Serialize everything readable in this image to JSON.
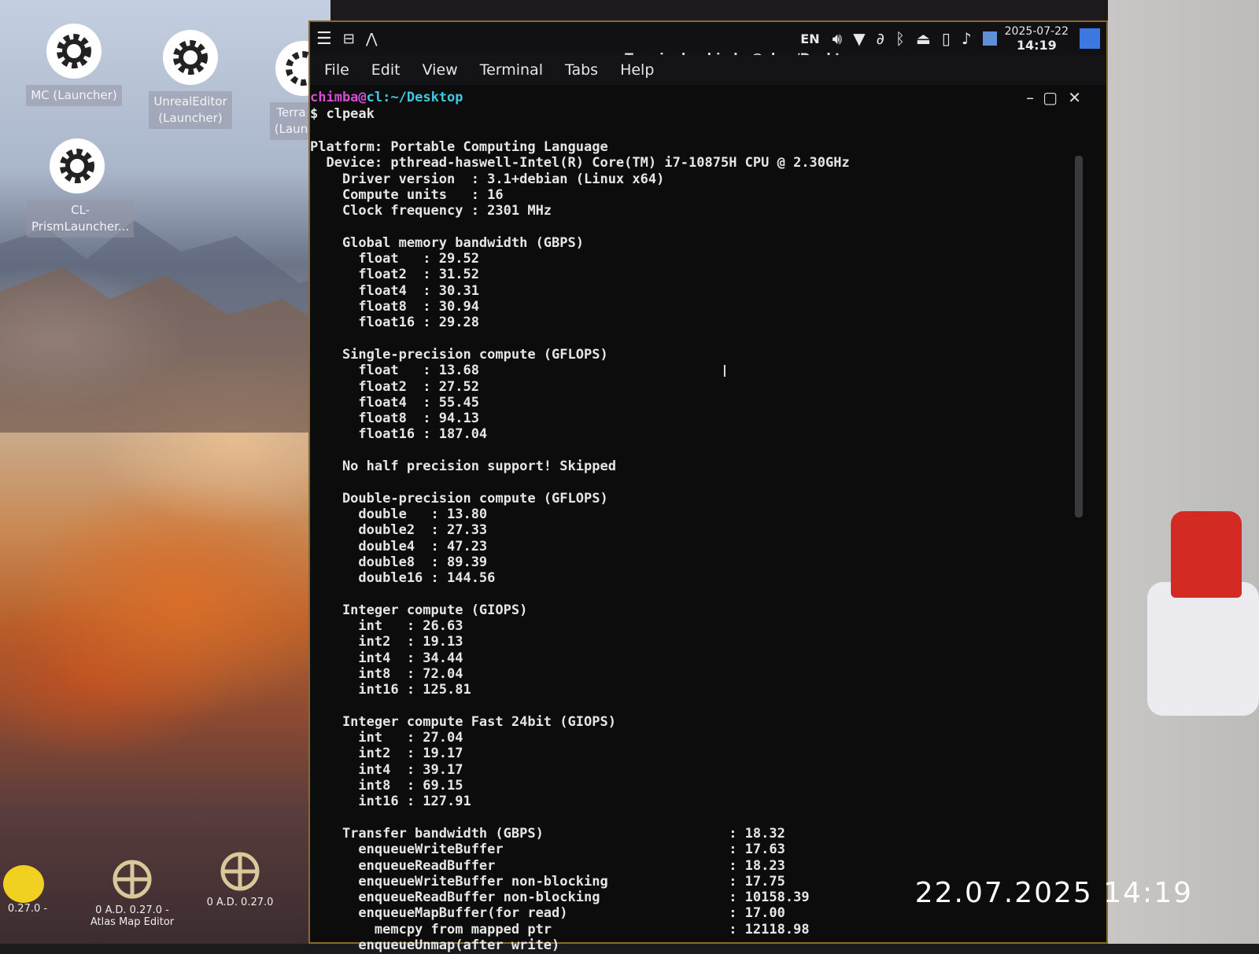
{
  "desktop": {
    "icons": [
      {
        "label": "MC (Launcher)"
      },
      {
        "label": "UnrealEditor\n(Launcher)"
      },
      {
        "label": "Terra\n(Laun"
      },
      {
        "label": "CL-\nPrismLauncher..."
      }
    ],
    "bottom_icons": [
      {
        "label": "0.27.0 -"
      },
      {
        "label": "0 A.D. 0.27.0 -\nAtlas Map Editor"
      },
      {
        "label": "0 A.D. 0.27.0"
      }
    ]
  },
  "panel": {
    "language": "EN",
    "date": "2025-07-22",
    "time": "14:19",
    "icons": [
      "menu-icon",
      "lock-icon",
      "chevron-up-icon",
      "volume-icon",
      "wifi-icon",
      "paperclip-icon",
      "bluetooth-icon",
      "eject-icon",
      "battery-icon",
      "bell-icon",
      "workspace-icon"
    ]
  },
  "window": {
    "title": "Terminal - chimba@cl: ~/Desktop",
    "menu": [
      "File",
      "Edit",
      "View",
      "Terminal",
      "Tabs",
      "Help"
    ],
    "controls": [
      "minimize-icon",
      "maximize-icon",
      "close-icon"
    ]
  },
  "terminal": {
    "prompt_user": "chimba",
    "prompt_host": "cl",
    "prompt_path": ":~/Desktop",
    "command": "$ clpeak",
    "lines": [
      "Platform: Portable Computing Language",
      "  Device: pthread-haswell-Intel(R) Core(TM) i7-10875H CPU @ 2.30GHz",
      "    Driver version  : 3.1+debian (Linux x64)",
      "    Compute units   : 16",
      "    Clock frequency : 2301 MHz",
      "",
      "    Global memory bandwidth (GBPS)",
      "      float   : 29.52",
      "      float2  : 31.52",
      "      float4  : 30.31",
      "      float8  : 30.94",
      "      float16 : 29.28",
      "",
      "    Single-precision compute (GFLOPS)",
      "      float   : 13.68",
      "      float2  : 27.52",
      "      float4  : 55.45",
      "      float8  : 94.13",
      "      float16 : 187.04",
      "",
      "    No half precision support! Skipped",
      "",
      "    Double-precision compute (GFLOPS)",
      "      double   : 13.80",
      "      double2  : 27.33",
      "      double4  : 47.23",
      "      double8  : 89.39",
      "      double16 : 144.56",
      "",
      "    Integer compute (GIOPS)",
      "      int   : 26.63",
      "      int2  : 19.13",
      "      int4  : 34.44",
      "      int8  : 72.04",
      "      int16 : 125.81",
      "",
      "    Integer compute Fast 24bit (GIOPS)",
      "      int   : 27.04",
      "      int2  : 19.17",
      "      int4  : 39.17",
      "      int8  : 69.15",
      "      int16 : 127.91",
      "",
      "    Transfer bandwidth (GBPS)                       : 18.32",
      "      enqueueWriteBuffer                            : 17.63",
      "      enqueueReadBuffer                             : 18.23",
      "      enqueueWriteBuffer non-blocking               : 17.75",
      "      enqueueReadBuffer non-blocking                : 10158.39",
      "      enqueueMapBuffer(for read)                    : 17.00",
      "        memcpy from mapped ptr                      : 12118.98",
      "      enqueueUnmap(after write)"
    ]
  },
  "photo_timestamp": "22.07.2025 14:19"
}
